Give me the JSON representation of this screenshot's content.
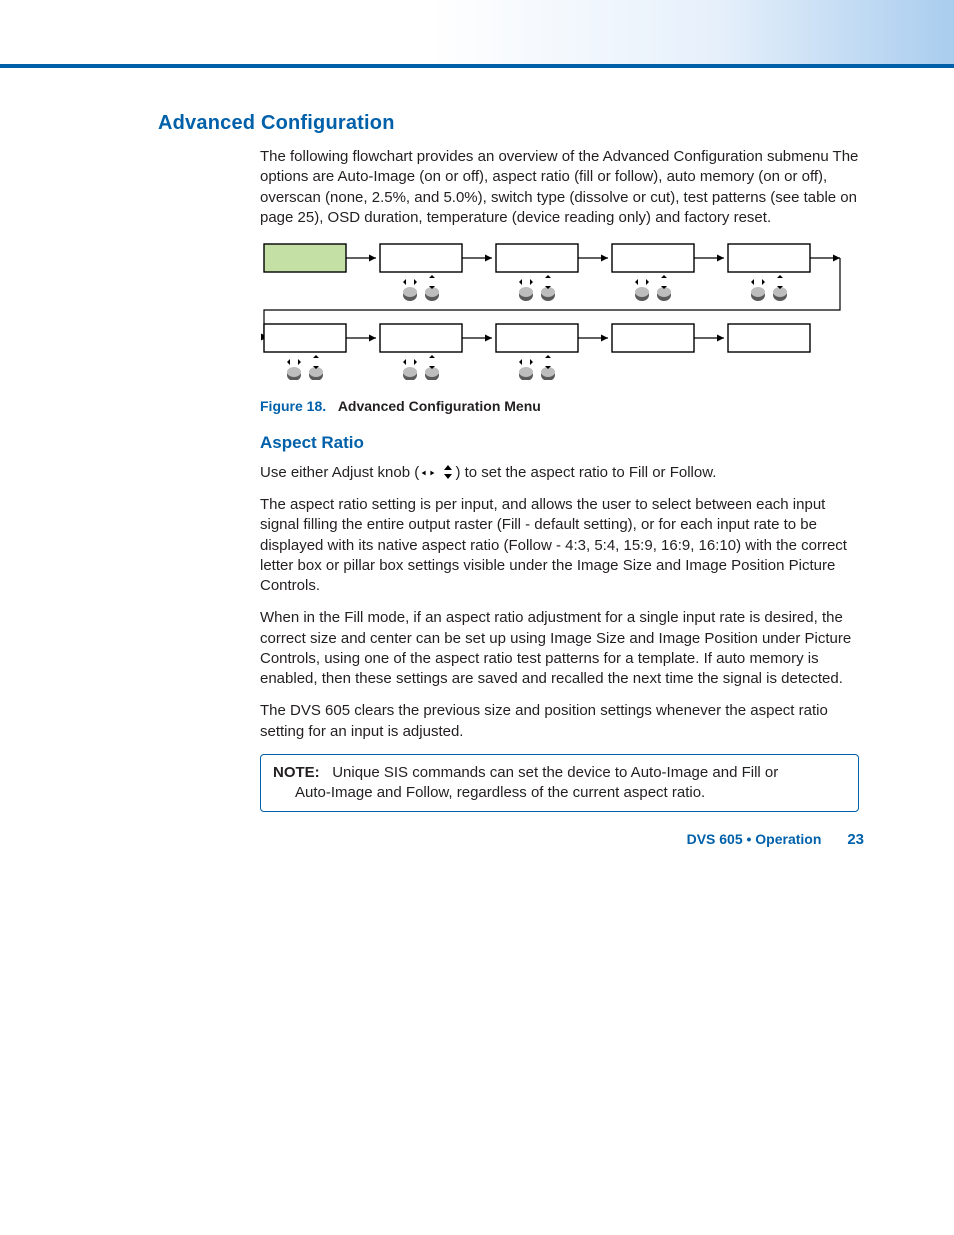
{
  "section_heading": "Advanced Configuration",
  "intro_paragraph": "The following flowchart provides an overview of the Advanced Configuration submenu The options are Auto-Image (on or off), aspect ratio (fill or follow), auto memory (on or off), overscan (none, 2.5%, and 5.0%), switch type (dissolve or cut), test patterns (see table on page 25), OSD duration, temperature (device reading only) and factory reset.",
  "figure": {
    "label": "Figure 18.",
    "title": "Advanced Configuration Menu"
  },
  "subsection_heading": "Aspect Ratio",
  "aspect_use_prefix": "Use either Adjust knob (",
  "aspect_use_suffix": ") to set the aspect ratio to Fill or Follow.",
  "aspect_p2": "The aspect ratio setting is per input, and allows the user to select between each input signal filling the entire output raster (Fill - default setting), or for each input rate to be displayed with its native aspect ratio (Follow - 4:3, 5:4, 15:9, 16:9, 16:10) with the correct letter box or pillar box settings visible under the Image Size and Image Position Picture Controls.",
  "aspect_p3": "When in the Fill mode, if an aspect ratio adjustment for a single input rate is desired, the correct size and center can be set up using Image Size and Image Position under Picture Controls, using one of the aspect ratio test patterns for a template. If auto memory is enabled, then these settings are saved and recalled the next time the signal is detected.",
  "aspect_p4": "The DVS 605 clears the previous size and position settings whenever the aspect ratio setting for an input is adjusted.",
  "note": {
    "label": "NOTE:",
    "line1": "Unique SIS commands can set the device to Auto-Image and Fill or",
    "line2": "Auto-Image and Follow, regardless of the current aspect ratio."
  },
  "footer": {
    "doc": "DVS 605 • Operation",
    "page": "23"
  },
  "flowchart": {
    "rows": [
      {
        "boxes": 5,
        "first_highlight": true,
        "knob_pairs_after_first": true
      },
      {
        "boxes": 5,
        "first_highlight": false,
        "knob_pairs_after_first": false,
        "knob_pairs_first_three": true
      }
    ]
  }
}
